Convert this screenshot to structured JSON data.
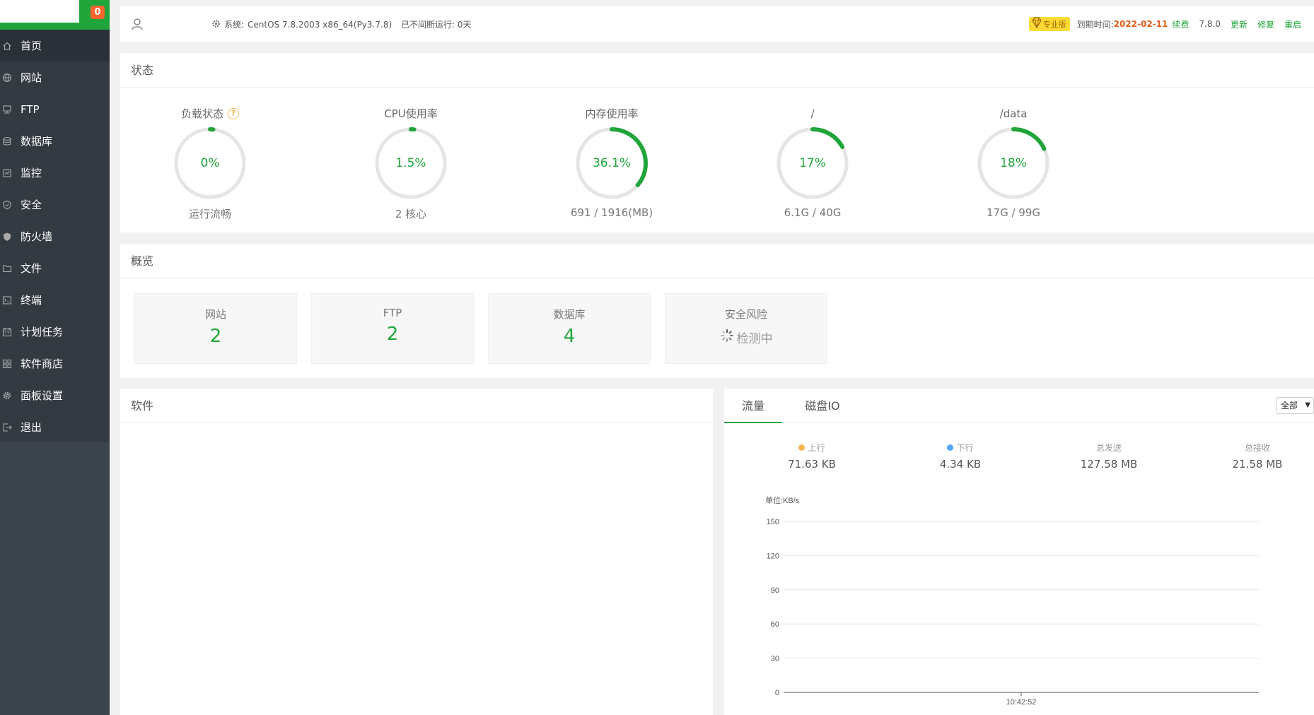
{
  "sidebar": {
    "notification_count": "0",
    "items": [
      {
        "label": "首页",
        "icon": "home-icon"
      },
      {
        "label": "网站",
        "icon": "globe-icon"
      },
      {
        "label": "FTP",
        "icon": "ftp-icon"
      },
      {
        "label": "数据库",
        "icon": "database-icon"
      },
      {
        "label": "监控",
        "icon": "monitor-icon"
      },
      {
        "label": "安全",
        "icon": "shield-icon"
      },
      {
        "label": "防火墙",
        "icon": "firewall-icon"
      },
      {
        "label": "文件",
        "icon": "folder-icon"
      },
      {
        "label": "终端",
        "icon": "terminal-icon"
      },
      {
        "label": "计划任务",
        "icon": "calendar-icon"
      },
      {
        "label": "软件商店",
        "icon": "apps-icon"
      },
      {
        "label": "面板设置",
        "icon": "gear-icon"
      },
      {
        "label": "退出",
        "icon": "logout-icon"
      }
    ]
  },
  "topbar": {
    "system_label": "系统:",
    "system_value": "CentOS 7.8.2003 x86_64(Py3.7.8)",
    "uptime": "已不间断运行: 0天",
    "pro_label": "专业版",
    "expire_label": "到期时间:",
    "expire_date": "2022-02-11",
    "renew": "续费",
    "version": "7.8.0",
    "update": "更新",
    "repair": "修复",
    "restart": "重启"
  },
  "status": {
    "title": "状态",
    "gauges": [
      {
        "title": "负载状态",
        "value": "0%",
        "percent": 0,
        "sub": "运行流畅",
        "help": "?"
      },
      {
        "title": "CPU使用率",
        "value": "1.5%",
        "percent": 1.5,
        "sub": "2 核心"
      },
      {
        "title": "内存使用率",
        "value": "36.1%",
        "percent": 36.1,
        "sub": "691 / 1916(MB)"
      },
      {
        "title": "/",
        "value": "17%",
        "percent": 17,
        "sub": "6.1G / 40G"
      },
      {
        "title": "/data",
        "value": "18%",
        "percent": 18,
        "sub": "17G / 99G"
      }
    ]
  },
  "overview": {
    "title": "概览",
    "cards": [
      {
        "label": "网站",
        "value": "2"
      },
      {
        "label": "FTP",
        "value": "2"
      },
      {
        "label": "数据库",
        "value": "4"
      },
      {
        "label": "安全风险",
        "value": "检测中"
      }
    ]
  },
  "software": {
    "title": "软件"
  },
  "traffic": {
    "tabs": [
      "流量",
      "磁盘IO"
    ],
    "select_value": "全部",
    "stats": [
      {
        "label": "上行",
        "value": "71.63 KB",
        "color": "#f7b851"
      },
      {
        "label": "下行",
        "value": "4.34 KB",
        "color": "#52a9ff"
      },
      {
        "label": "总发送",
        "value": "127.58 MB"
      },
      {
        "label": "总接收",
        "value": "21.58 MB"
      }
    ]
  },
  "colors": {
    "accent": "#20a53a",
    "sidebar": "#3c444d",
    "badge": "#f7642c"
  },
  "chart_data": {
    "type": "line",
    "unit_label": "单位:KB/s",
    "ylim": [
      0,
      150
    ],
    "yticks": [
      "150",
      "120",
      "90",
      "60",
      "30",
      "0"
    ],
    "x": [
      "10:42:52"
    ],
    "series": [],
    "grid": true
  }
}
